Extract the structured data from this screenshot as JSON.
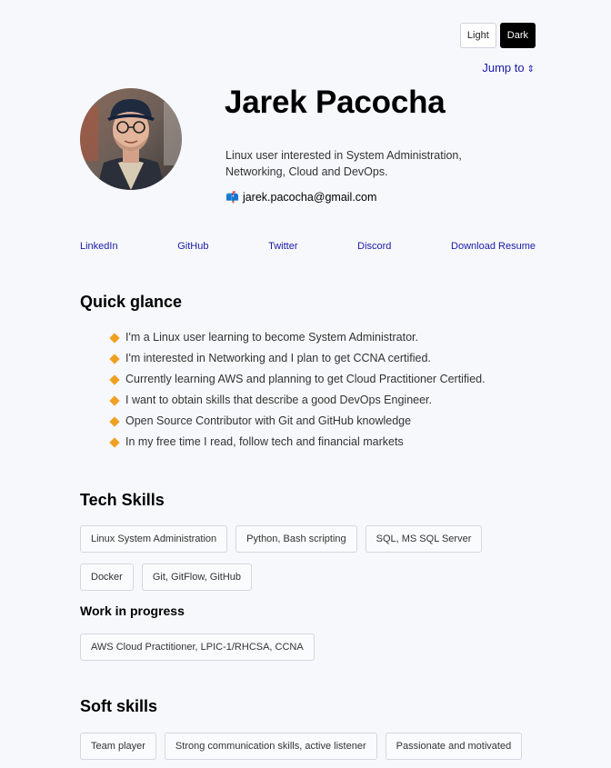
{
  "theme": {
    "light_label": "Light",
    "dark_label": "Dark",
    "active": "dark"
  },
  "jump_to": {
    "label": "Jump to",
    "icon": "updown-arrow-icon"
  },
  "profile": {
    "name": "Jarek Pacocha",
    "bio": "Linux user interested in System Administration, Networking, Cloud and DevOps.",
    "email_icon": "mailbox-icon",
    "email": "jarek.pacocha@gmail.com"
  },
  "links": [
    {
      "label": "LinkedIn"
    },
    {
      "label": "GitHub"
    },
    {
      "label": "Twitter"
    },
    {
      "label": "Discord"
    },
    {
      "label": "Download Resume"
    }
  ],
  "quick_glance": {
    "title": "Quick glance",
    "items": [
      "I'm a Linux user learning to become System Administrator.",
      "I'm interested in Networking and I plan to get CCNA certified.",
      "Currently learning AWS and planning to get Cloud Practitioner Certified.",
      "I want to obtain skills that describe a good DevOps Engineer.",
      "Open Source Contributor with Git and GitHub knowledge",
      "In my free time I read, follow tech and financial markets"
    ]
  },
  "tech_skills": {
    "title": "Tech Skills",
    "items": [
      "Linux System Administration",
      "Python, Bash scripting",
      "SQL, MS SQL Server",
      "Docker",
      "Git, GitFlow, GitHub"
    ]
  },
  "work_in_progress": {
    "title": "Work in progress",
    "items": [
      "AWS Cloud Practitioner, LPIC-1/RHCSA, CCNA"
    ]
  },
  "soft_skills": {
    "title": "Soft skills",
    "items": [
      "Team player",
      "Strong communication skills, active listener",
      "Passionate and motivated"
    ]
  },
  "colors": {
    "link": "#1a1aa8",
    "bullet": "#f0a020",
    "background": "#f7f8fb"
  }
}
